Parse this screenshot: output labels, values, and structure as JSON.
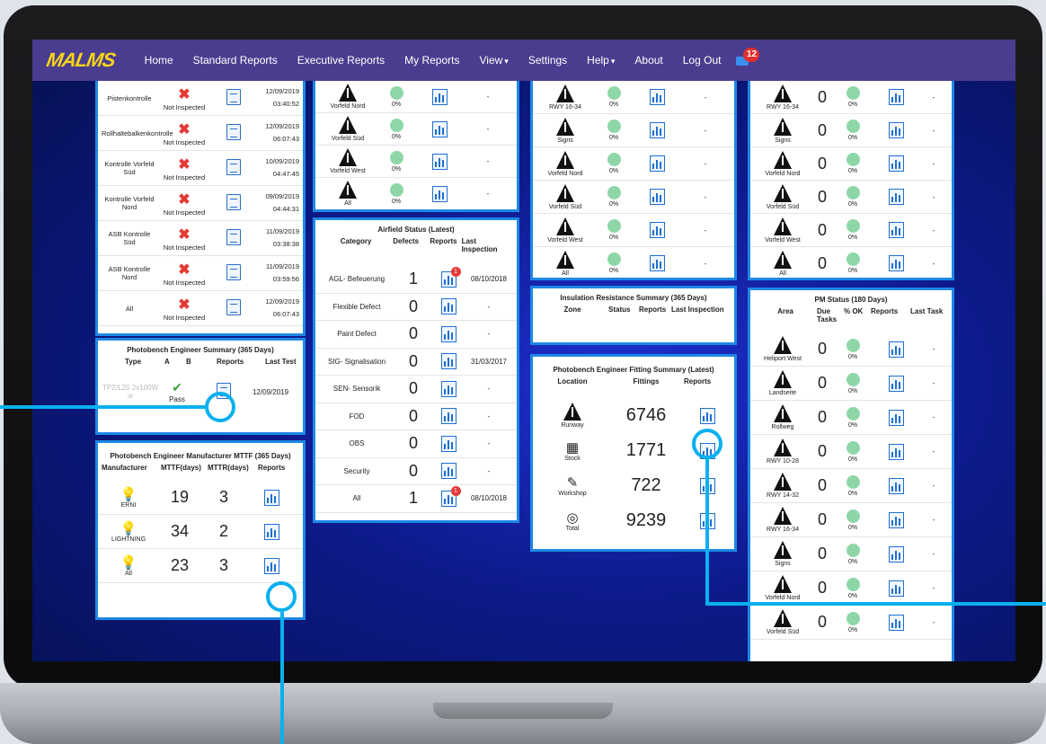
{
  "nav": {
    "logo": "MALMS",
    "items": [
      "Home",
      "Standard Reports",
      "Executive Reports",
      "My Reports",
      "View",
      "Settings",
      "Help",
      "About",
      "Log Out"
    ],
    "badge": "12"
  },
  "p1": {
    "rows": [
      {
        "name": "Pistenkontrolle",
        "status": "Not Inspected",
        "date": "12/09/2019",
        "time": "03:40:52"
      },
      {
        "name": "Rollhaltebalkenkontrolle",
        "status": "Not Inspected",
        "date": "12/09/2019",
        "time": "06:07:43"
      },
      {
        "name": "Kontrolle Vorfeld Süd",
        "status": "Not Inspected",
        "date": "10/09/2019",
        "time": "04:47:45"
      },
      {
        "name": "Kontrolle Vorfeld Nord",
        "status": "Not Inspected",
        "date": "09/09/2019",
        "time": "04:44:31"
      },
      {
        "name": "ASB Kontrolle Süd",
        "status": "Not Inspected",
        "date": "11/09/2019",
        "time": "03:38:38"
      },
      {
        "name": "ASB Kontrolle Nord",
        "status": "Not Inspected",
        "date": "11/09/2019",
        "time": "03:59:56"
      },
      {
        "name": "All",
        "status": "Not Inspected",
        "date": "12/09/2019",
        "time": "06:07:43"
      }
    ]
  },
  "p2": {
    "rows": [
      {
        "name": "Vorfeld Nord",
        "pct": "0%",
        "last": "-"
      },
      {
        "name": "Vorfeld Süd",
        "pct": "0%",
        "last": "-"
      },
      {
        "name": "Vorfeld West",
        "pct": "0%",
        "last": "-"
      },
      {
        "name": "All",
        "pct": "0%",
        "last": "-"
      }
    ]
  },
  "p3": {
    "title": "Airfield Status (Latest)",
    "headers": [
      "Category",
      "Defects",
      "Reports",
      "Last Inspection"
    ],
    "rows": [
      {
        "cat": "AGL- Befeuerung",
        "def": "1",
        "last": "08/10/2018",
        "badge": "1"
      },
      {
        "cat": "Flexible Defect",
        "def": "0",
        "last": "-",
        "badge": ""
      },
      {
        "cat": "Paint Defect",
        "def": "0",
        "last": "-",
        "badge": ""
      },
      {
        "cat": "SIG- Signalisation",
        "def": "0",
        "last": "31/03/2017",
        "badge": ""
      },
      {
        "cat": "SEN- Sensorik",
        "def": "0",
        "last": "-",
        "badge": ""
      },
      {
        "cat": "FOD",
        "def": "0",
        "last": "-",
        "badge": ""
      },
      {
        "cat": "OBS",
        "def": "0",
        "last": "-",
        "badge": ""
      },
      {
        "cat": "Security",
        "def": "0",
        "last": "-",
        "badge": ""
      },
      {
        "cat": "All",
        "def": "1",
        "last": "08/10/2018",
        "badge": "1"
      }
    ]
  },
  "p4": {
    "title": "Photobench Engineer Summary (365 Days)",
    "headers": [
      "Type",
      "A",
      "B",
      "Reports",
      "Last Test"
    ],
    "type": "TPZ/L20 2x100W w",
    "result": "Pass",
    "date": "12/09/2019"
  },
  "p5": {
    "title": "Photobench Engineer Manufacturer MTTF (365 Days)",
    "headers": [
      "Manufacturer",
      "MTTF(days)",
      "MTTR(days)",
      "Reports"
    ],
    "rows": [
      {
        "name": "ERNI",
        "mttf": "19",
        "mttr": "3"
      },
      {
        "name": "LIGHTNING",
        "mttf": "34",
        "mttr": "2"
      },
      {
        "name": "All",
        "mttf": "23",
        "mttr": "3"
      }
    ]
  },
  "p6": {
    "rows": [
      {
        "name": "RWY 16-34",
        "pct": "0%",
        "last": "-"
      },
      {
        "name": "Signs",
        "pct": "0%",
        "last": "-"
      },
      {
        "name": "Vorfeld Nord",
        "pct": "0%",
        "last": "-"
      },
      {
        "name": "Vorfeld Süd",
        "pct": "0%",
        "last": "-"
      },
      {
        "name": "Vorfeld West",
        "pct": "0%",
        "last": "-"
      },
      {
        "name": "All",
        "pct": "0%",
        "last": "-"
      }
    ]
  },
  "p7": {
    "title": "Insulation Resistance Summary (365 Days)",
    "headers": [
      "Zone",
      "Status",
      "Reports",
      "Last Inspection"
    ]
  },
  "p8": {
    "title": "Photobench Engineer Fitting Summary (Latest)",
    "headers": [
      "Location",
      "Fittings",
      "Reports"
    ],
    "rows": [
      {
        "name": "Runway",
        "val": "6746"
      },
      {
        "name": "Stock",
        "val": "1771"
      },
      {
        "name": "Workshop",
        "val": "722"
      },
      {
        "name": "Total",
        "val": "9239"
      }
    ]
  },
  "p9": {
    "rows": [
      {
        "name": "RWY 16-34",
        "due": "0",
        "pct": "0%",
        "last": "-"
      },
      {
        "name": "Signs",
        "due": "0",
        "pct": "0%",
        "last": "-"
      },
      {
        "name": "Vorfeld Nord",
        "due": "0",
        "pct": "0%",
        "last": "-"
      },
      {
        "name": "Vorfeld Süd",
        "due": "0",
        "pct": "0%",
        "last": "-"
      },
      {
        "name": "Vorfeld West",
        "due": "0",
        "pct": "0%",
        "last": "-"
      },
      {
        "name": "All",
        "due": "0",
        "pct": "0%",
        "last": "-"
      }
    ]
  },
  "p10": {
    "title": "PM Status (180 Days)",
    "headers": [
      "Area",
      "Due Tasks",
      "% OK",
      "Reports",
      "Last Task"
    ],
    "rows": [
      {
        "name": "Heliport West",
        "due": "0",
        "pct": "0%",
        "last": "-"
      },
      {
        "name": "Landseite",
        "due": "0",
        "pct": "0%",
        "last": "-"
      },
      {
        "name": "Rollweg",
        "due": "0",
        "pct": "0%",
        "last": "-"
      },
      {
        "name": "RWY 10-28",
        "due": "0",
        "pct": "0%",
        "last": "-"
      },
      {
        "name": "RWY 14-32",
        "due": "0",
        "pct": "0%",
        "last": "-"
      },
      {
        "name": "RWY 16-34",
        "due": "0",
        "pct": "0%",
        "last": "-"
      },
      {
        "name": "Signs",
        "due": "0",
        "pct": "0%",
        "last": "-"
      },
      {
        "name": "Vorfeld Nord",
        "due": "0",
        "pct": "0%",
        "last": "-"
      },
      {
        "name": "Vorfeld Süd",
        "due": "0",
        "pct": "0%",
        "last": "-"
      }
    ]
  }
}
